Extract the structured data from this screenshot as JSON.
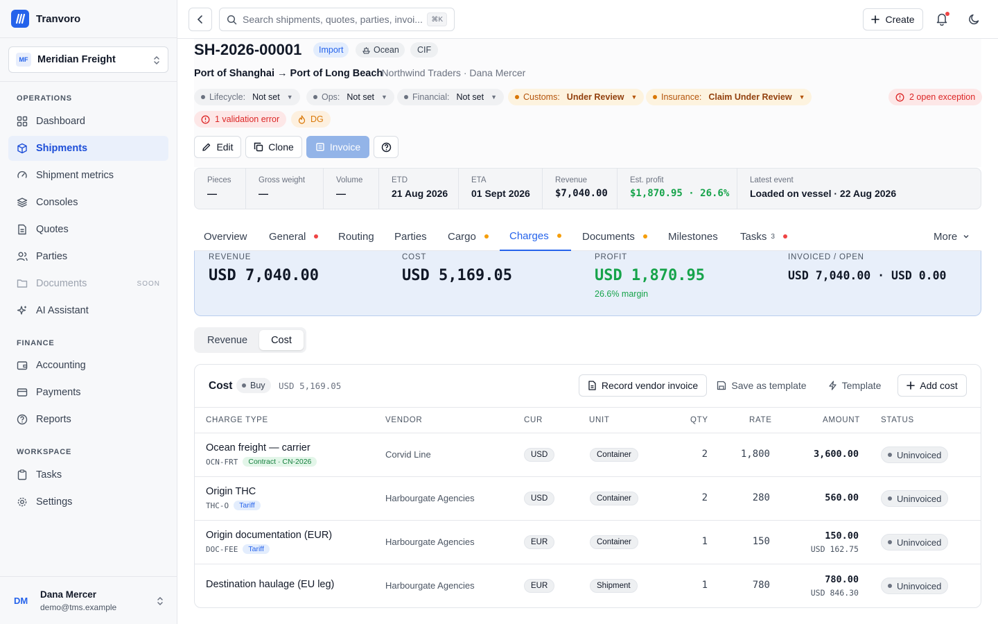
{
  "app": {
    "name": "Tranvoro"
  },
  "org": {
    "badge": "MF",
    "name": "Meridian Freight"
  },
  "sidebar": {
    "sections": {
      "operations": "OPERATIONS",
      "finance": "FINANCE",
      "workspace": "WORKSPACE"
    },
    "items": [
      {
        "label": "Dashboard"
      },
      {
        "label": "Shipments"
      },
      {
        "label": "Shipment metrics"
      },
      {
        "label": "Consoles"
      },
      {
        "label": "Quotes"
      },
      {
        "label": "Parties"
      },
      {
        "label": "Documents",
        "badge": "SOON"
      },
      {
        "label": "AI Assistant"
      },
      {
        "label": "Accounting"
      },
      {
        "label": "Payments"
      },
      {
        "label": "Reports"
      },
      {
        "label": "Tasks"
      },
      {
        "label": "Settings"
      }
    ]
  },
  "user": {
    "initials": "DM",
    "name": "Dana Mercer",
    "email": "demo@tms.example"
  },
  "topbar": {
    "search_placeholder": "Search shipments, quotes, parties, invoi...",
    "shortcut": "⌘K",
    "create_label": "Create"
  },
  "shipment": {
    "id": "SH-2026-00001",
    "chips": [
      "Import",
      "Ocean",
      "CIF"
    ],
    "route": "Port of Shanghai → Port of Long Beach",
    "meta": "· Northwind Traders · Dana Mercer",
    "statuses": [
      {
        "label": "Lifecycle:",
        "value": "Not set"
      },
      {
        "label": "Ops:",
        "value": "Not set"
      },
      {
        "label": "Financial:",
        "value": "Not set"
      },
      {
        "label": "Customs:",
        "value": "Under Review"
      },
      {
        "label": "Insurance:",
        "value": "Claim Under Review"
      }
    ],
    "exceptions": "2 open exception",
    "validation": "1 validation error",
    "dg": "DG"
  },
  "actions": {
    "edit": "Edit",
    "clone": "Clone",
    "invoice": "Invoice"
  },
  "stats": [
    {
      "label": "Pieces",
      "value": "—"
    },
    {
      "label": "Gross weight",
      "value": "—"
    },
    {
      "label": "Volume",
      "value": "—"
    },
    {
      "label": "ETD",
      "value": "21 Aug 2026"
    },
    {
      "label": "ETA",
      "value": "01 Sept 2026"
    },
    {
      "label": "Revenue",
      "value": "$7,040.00"
    },
    {
      "label": "Est. profit",
      "value": "$1,870.95 · 26.6%"
    },
    {
      "label": "Latest event",
      "value": "Loaded on vessel · 22 Aug 2026"
    }
  ],
  "tabs": [
    {
      "label": "Overview"
    },
    {
      "label": "General"
    },
    {
      "label": "Routing"
    },
    {
      "label": "Parties"
    },
    {
      "label": "Cargo"
    },
    {
      "label": "Charges"
    },
    {
      "label": "Documents"
    },
    {
      "label": "Milestones"
    },
    {
      "label": "Tasks",
      "count": "3"
    },
    {
      "label": "More"
    }
  ],
  "summary": {
    "revenue": {
      "label": "REVENUE",
      "value": "USD 7,040.00"
    },
    "cost": {
      "label": "COST",
      "value": "USD 5,169.05"
    },
    "profit": {
      "label": "PROFIT",
      "value": "USD 1,870.95",
      "sub": "26.6% margin"
    },
    "invoiced": {
      "label": "INVOICED / OPEN",
      "value": "USD 7,040.00 · USD 0.00"
    }
  },
  "segment": {
    "revenue": "Revenue",
    "cost": "Cost"
  },
  "cost_card": {
    "title": "Cost",
    "badge": "Buy",
    "total": "USD 5,169.05",
    "buttons": {
      "record": "Record vendor invoice",
      "save_template": "Save as template",
      "template": "Template",
      "add": "Add cost"
    },
    "columns": [
      "CHARGE TYPE",
      "VENDOR",
      "CUR",
      "UNIT",
      "QTY",
      "RATE",
      "AMOUNT",
      "STATUS"
    ],
    "rows": [
      {
        "name": "Ocean freight — carrier",
        "code": "OCN-FRT",
        "tag": "Contract · CN-2026",
        "vendor": "Corvid Line",
        "cur": "USD",
        "unit": "Container",
        "qty": "2",
        "rate": "1,800",
        "amount": "3,600.00",
        "amount_sub": "",
        "status": "Uninvoiced"
      },
      {
        "name": "Origin THC",
        "code": "THC-O",
        "tag": "Tariff",
        "vendor": "Harbourgate Agencies",
        "cur": "USD",
        "unit": "Container",
        "qty": "2",
        "rate": "280",
        "amount": "560.00",
        "amount_sub": "",
        "status": "Uninvoiced"
      },
      {
        "name": "Origin documentation (EUR)",
        "code": "DOC-FEE",
        "tag": "Tariff",
        "vendor": "Harbourgate Agencies",
        "cur": "EUR",
        "unit": "Container",
        "qty": "1",
        "rate": "150",
        "amount": "150.00",
        "amount_sub": "USD 162.75",
        "status": "Uninvoiced"
      },
      {
        "name": "Destination haulage (EU leg)",
        "code": "",
        "tag": "",
        "vendor": "Harbourgate Agencies",
        "cur": "EUR",
        "unit": "Shipment",
        "qty": "1",
        "rate": "780",
        "amount": "780.00",
        "amount_sub": "USD 846.30",
        "status": "Uninvoiced"
      }
    ]
  },
  "colors": {
    "accent": "#2563eb",
    "sidebar_bg": "#f7f8fa",
    "profit": "#16a34a",
    "amber": "#b45309",
    "danger": "#dc2626"
  }
}
